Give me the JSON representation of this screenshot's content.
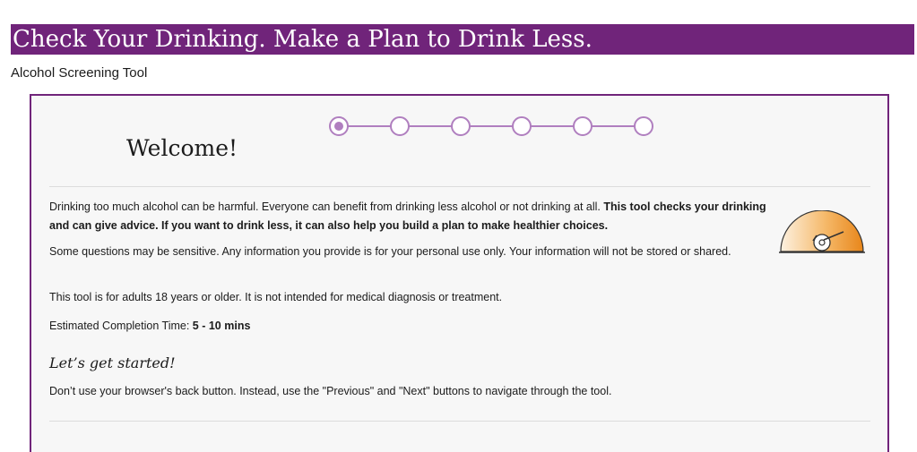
{
  "header": {
    "title": "Check Your Drinking. Make a Plan to Drink Less.",
    "subtitle": "Alcohol Screening Tool",
    "brand_color": "#70247a"
  },
  "progress": {
    "total_steps": 6,
    "current_step": 1,
    "color": "#b07fbf"
  },
  "card": {
    "welcome": "Welcome!",
    "intro_plain": "Drinking too much alcohol can be harmful. Everyone can benefit from drinking less alcohol or not drinking at all. ",
    "intro_bold": "This tool checks your drinking and can give advice. If you want to drink less, it can also help you build a plan to make healthier choices.",
    "privacy": "Some questions may be sensitive. Any information you provide is for your personal use only. Your information will not be stored or shared.",
    "age_notice": "This tool is for adults 18 years or older. It is not intended for medical diagnosis or treatment.",
    "time_label": "Estimated Completion Time: ",
    "time_value": "5 - 10 mins",
    "lets_start": "Let’s get started!",
    "nav_note": "Don’t use your browser's back button. Instead, use the \"Previous\" and \"Next\" buttons to navigate through the tool.",
    "gauge_icon": "speedometer-icon",
    "gauge_colors": [
      "#f9d39a",
      "#f0a040",
      "#e8861a"
    ]
  }
}
